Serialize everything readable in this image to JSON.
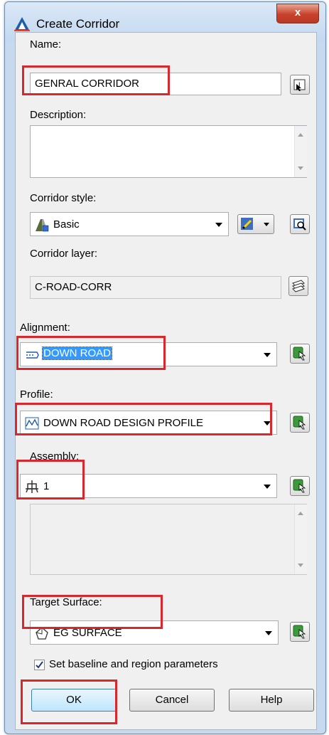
{
  "window": {
    "title": "Create Corridor",
    "close_glyph": "x"
  },
  "name": {
    "label": "Name:",
    "value": "GENRAL CORRIDOR"
  },
  "description": {
    "label": "Description:",
    "value": ""
  },
  "corridor_style": {
    "label": "Corridor style:",
    "value": "Basic"
  },
  "corridor_layer": {
    "label": "Corridor layer:",
    "value": "C-ROAD-CORR"
  },
  "alignment": {
    "label": "Alignment:",
    "value": "DOWN ROAD"
  },
  "profile": {
    "label": "Profile:",
    "value": "DOWN ROAD DESIGN PROFILE"
  },
  "assembly": {
    "label": "Assembly:",
    "value": "1"
  },
  "target_surface": {
    "label": "Target Surface:",
    "value": "EG SURFACE"
  },
  "baseline_checkbox": {
    "label": "Set baseline and region parameters",
    "checked": true
  },
  "buttons": {
    "ok": "OK",
    "cancel": "Cancel",
    "help": "Help"
  },
  "colors": {
    "highlight": "#d9272e",
    "dialog_bg": "#f0f0f0",
    "title_bg": "#c6d9ee",
    "selection": "#3399ff"
  }
}
